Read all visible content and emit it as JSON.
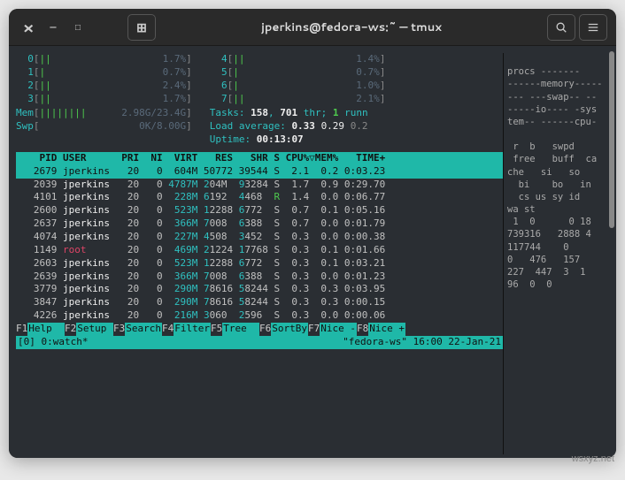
{
  "titlebar": {
    "close": "×",
    "minimize": "—",
    "maximize": "□",
    "newtab": "⊞",
    "title": "jperkins@fedora-ws:~ — tmux",
    "search_icon": "🔍",
    "menu_icon": "≡"
  },
  "cpu_meters": {
    "left": [
      {
        "id": "0",
        "bar": "||",
        "val": "1.7%"
      },
      {
        "id": "1",
        "bar": "|",
        "val": "0.7%"
      },
      {
        "id": "2",
        "bar": "||",
        "val": "2.4%"
      },
      {
        "id": "3",
        "bar": "||",
        "val": "1.7%"
      }
    ],
    "right": [
      {
        "id": "4",
        "bar": "||",
        "val": "1.4%"
      },
      {
        "id": "5",
        "bar": "|",
        "val": "0.7%"
      },
      {
        "id": "6",
        "bar": "|",
        "val": "1.0%"
      },
      {
        "id": "7",
        "bar": "||",
        "val": "2.1%"
      }
    ]
  },
  "mem": {
    "label": "Mem",
    "bar": "||||||||",
    "val": "2.98G/23.4G"
  },
  "swp": {
    "label": "Swp",
    "bar": "",
    "val": "0K/8.00G"
  },
  "tasks": {
    "label": "Tasks:",
    "procs": "158",
    "sep": ",",
    "thr": "701",
    "thr_label": "thr;",
    "run": "1",
    "run_label": "runn"
  },
  "load": {
    "label": "Load average:",
    "a": "0.33",
    "b": "0.29",
    "c": "0.2"
  },
  "uptime": {
    "label": "Uptime:",
    "val": "00:13:07"
  },
  "columns": "    PID USER      PRI  NI  VIRT   RES   SHR S CPU%▽MEM%   TIME+",
  "processes": [
    {
      "sel": true,
      "pid": " 2679",
      "user": "jperkins",
      "pri": "20",
      "ni": "0",
      "virt": "604M",
      "res": "50772",
      "shr": "39544",
      "s": "S",
      "cpu": "2.1",
      "mem": "0.2",
      "time": "0:03.23"
    },
    {
      "sel": false,
      "pid": " 2039",
      "user": "jperkins",
      "pri": "20",
      "ni": "0",
      "virt": "4787M",
      "res": "204M",
      "shr": "93284",
      "s": "S",
      "cpu": "1.7",
      "mem": "0.9",
      "time": "0:29.70"
    },
    {
      "sel": false,
      "pid": " 4101",
      "user": "jperkins",
      "pri": "20",
      "ni": "0",
      "virt": "228M",
      "res": "6192",
      "shr": "4468",
      "s": "R",
      "cpu": "1.4",
      "mem": "0.0",
      "time": "0:06.77"
    },
    {
      "sel": false,
      "pid": " 2600",
      "user": "jperkins",
      "pri": "20",
      "ni": "0",
      "virt": "523M",
      "res": "12288",
      "shr": "6772",
      "s": "S",
      "cpu": "0.7",
      "mem": "0.1",
      "time": "0:05.16"
    },
    {
      "sel": false,
      "pid": " 2637",
      "user": "jperkins",
      "pri": "20",
      "ni": "0",
      "virt": "366M",
      "res": "7008",
      "shr": "6388",
      "s": "S",
      "cpu": "0.7",
      "mem": "0.0",
      "time": "0:01.79"
    },
    {
      "sel": false,
      "pid": " 4074",
      "user": "jperkins",
      "pri": "20",
      "ni": "0",
      "virt": "227M",
      "res": "4508",
      "shr": "3452",
      "s": "S",
      "cpu": "0.3",
      "mem": "0.0",
      "time": "0:00.38"
    },
    {
      "sel": false,
      "pid": " 1149",
      "user": "root    ",
      "pri": "20",
      "ni": "0",
      "virt": "469M",
      "res": "21224",
      "shr": "17768",
      "s": "S",
      "cpu": "0.3",
      "mem": "0.1",
      "time": "0:01.66"
    },
    {
      "sel": false,
      "pid": " 2603",
      "user": "jperkins",
      "pri": "20",
      "ni": "0",
      "virt": "523M",
      "res": "12288",
      "shr": "6772",
      "s": "S",
      "cpu": "0.3",
      "mem": "0.1",
      "time": "0:03.21"
    },
    {
      "sel": false,
      "pid": " 2639",
      "user": "jperkins",
      "pri": "20",
      "ni": "0",
      "virt": "366M",
      "res": "7008",
      "shr": "6388",
      "s": "S",
      "cpu": "0.3",
      "mem": "0.0",
      "time": "0:01.23"
    },
    {
      "sel": false,
      "pid": " 3779",
      "user": "jperkins",
      "pri": "20",
      "ni": "0",
      "virt": "290M",
      "res": "78616",
      "shr": "58244",
      "s": "S",
      "cpu": "0.3",
      "mem": "0.3",
      "time": "0:03.95"
    },
    {
      "sel": false,
      "pid": " 3847",
      "user": "jperkins",
      "pri": "20",
      "ni": "0",
      "virt": "290M",
      "res": "78616",
      "shr": "58244",
      "s": "S",
      "cpu": "0.3",
      "mem": "0.3",
      "time": "0:00.15"
    },
    {
      "sel": false,
      "pid": " 4226",
      "user": "jperkins",
      "pri": "20",
      "ni": "0",
      "virt": "216M",
      "res": "3060",
      "shr": "2596",
      "s": "S",
      "cpu": "0.3",
      "mem": "0.0",
      "time": "0:00.06"
    }
  ],
  "fkeys": [
    {
      "k": "F1",
      "l": "Help  "
    },
    {
      "k": "F2",
      "l": "Setup "
    },
    {
      "k": "F3",
      "l": "Search"
    },
    {
      "k": "F4",
      "l": "Filter"
    },
    {
      "k": "F5",
      "l": "Tree  "
    },
    {
      "k": "F6",
      "l": "SortBy"
    },
    {
      "k": "F7",
      "l": "Nice -"
    },
    {
      "k": "F8",
      "l": "Nice +"
    }
  ],
  "tmux": {
    "left": "[0] 0:watch*",
    "right": "\"fedora-ws\" 16:00 22-Jan-21"
  },
  "right_pane_lines": [
    "",
    "procs -------",
    "------memory-----",
    "--- ---swap-- --",
    "-----io---- -sys",
    "tem-- ------cpu-",
    "",
    " r  b   swpd   ",
    " free   buff  ca",
    "che   si   so  ",
    "  bi    bo   in",
    "  cs us sy id",
    "wa st",
    " 1  0      0 18",
    "739316   2888 4",
    "117744    0    ",
    "0   476   157 ",
    "227  447  3  1 ",
    "96  0  0"
  ],
  "watermark": "wsxyz.net"
}
